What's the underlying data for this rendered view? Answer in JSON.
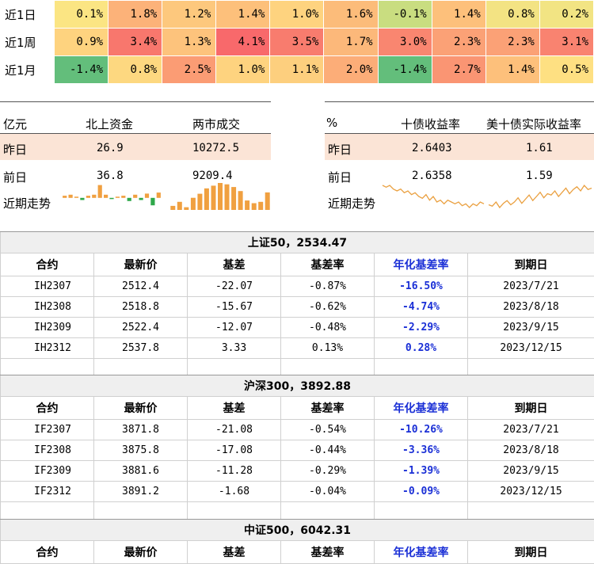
{
  "heatmap": {
    "rows": [
      {
        "label": "近1日",
        "values": [
          "0.1%",
          "1.8%",
          "1.2%",
          "1.4%",
          "1.0%",
          "1.6%",
          "-0.1%",
          "1.4%",
          "0.8%",
          "0.2%"
        ],
        "colors": [
          "#fbe583",
          "#fcb279",
          "#fdc87d",
          "#fdc07b",
          "#fed37f",
          "#fcbc7a",
          "#c9dd80",
          "#fdc07b",
          "#f3e383",
          "#f2e483"
        ]
      },
      {
        "label": "近1周",
        "values": [
          "0.9%",
          "3.4%",
          "1.3%",
          "4.1%",
          "3.5%",
          "1.7%",
          "3.0%",
          "2.3%",
          "2.3%",
          "3.1%"
        ],
        "colors": [
          "#fed37f",
          "#f8776d",
          "#fdc37c",
          "#f8696b",
          "#f87c6e",
          "#fcb87a",
          "#f98670",
          "#fba176",
          "#fba176",
          "#f98370"
        ]
      },
      {
        "label": "近1月",
        "values": [
          "-1.4%",
          "0.8%",
          "2.5%",
          "1.0%",
          "1.1%",
          "2.0%",
          "-1.4%",
          "2.7%",
          "1.4%",
          "0.5%"
        ],
        "colors": [
          "#63be7b",
          "#fdd880",
          "#fb9c74",
          "#fed37f",
          "#fdcf7e",
          "#fcad78",
          "#63be7b",
          "#fa9573",
          "#fdc07b",
          "#fee082"
        ]
      }
    ]
  },
  "flows": {
    "unit": "亿元",
    "col1": "北上资金",
    "col2": "两市成交",
    "yesterday_label": "昨日",
    "prev_label": "前日",
    "trend_label": "近期走势",
    "yesterday": [
      "26.9",
      "10272.5"
    ],
    "prev": [
      "36.8",
      "9209.4"
    ],
    "north_trend": [
      2,
      3,
      1,
      -2,
      2,
      3,
      12,
      3,
      -1,
      1,
      2,
      -3,
      3,
      -2,
      4,
      -7,
      5
    ],
    "turnover_trend": [
      3,
      6,
      2,
      9,
      12,
      16,
      18,
      20,
      19,
      17,
      14,
      7,
      5,
      6,
      13
    ]
  },
  "yields": {
    "unit": "%",
    "col1": "十债收益率",
    "col2": "美十债实际收益率",
    "yesterday_label": "昨日",
    "prev_label": "前日",
    "trend_label": "近期走势",
    "yesterday": [
      "2.6403",
      "1.61"
    ],
    "prev": [
      "2.6358",
      "1.59"
    ],
    "cn10y_trend": [
      2.74,
      2.73,
      2.74,
      2.72,
      2.71,
      2.72,
      2.7,
      2.71,
      2.69,
      2.7,
      2.68,
      2.67,
      2.69,
      2.66,
      2.68,
      2.65,
      2.66,
      2.64,
      2.66,
      2.65,
      2.64,
      2.65,
      2.63,
      2.64,
      2.62,
      2.64,
      2.63,
      2.65,
      2.64
    ],
    "us_real_trend": [
      1.5,
      1.49,
      1.52,
      1.48,
      1.51,
      1.53,
      1.5,
      1.52,
      1.55,
      1.51,
      1.54,
      1.57,
      1.53,
      1.56,
      1.59,
      1.55,
      1.58,
      1.57,
      1.6,
      1.56,
      1.59,
      1.62,
      1.58,
      1.61,
      1.63,
      1.6,
      1.64,
      1.61,
      1.62
    ]
  },
  "basis_headers": [
    "合约",
    "最新价",
    "基差",
    "基差率",
    "年化基差率",
    "到期日"
  ],
  "basis": [
    {
      "title": "上证50，2534.47",
      "rows": [
        [
          "IH2307",
          "2512.4",
          "-22.07",
          "-0.87%",
          "-16.50%",
          "2023/7/21"
        ],
        [
          "IH2308",
          "2518.8",
          "-15.67",
          "-0.62%",
          "-4.74%",
          "2023/8/18"
        ],
        [
          "IH2309",
          "2522.4",
          "-12.07",
          "-0.48%",
          "-2.29%",
          "2023/9/15"
        ],
        [
          "IH2312",
          "2537.8",
          "3.33",
          "0.13%",
          "0.28%",
          "2023/12/15"
        ]
      ]
    },
    {
      "title": "沪深300，3892.88",
      "rows": [
        [
          "IF2307",
          "3871.8",
          "-21.08",
          "-0.54%",
          "-10.26%",
          "2023/7/21"
        ],
        [
          "IF2308",
          "3875.8",
          "-17.08",
          "-0.44%",
          "-3.36%",
          "2023/8/18"
        ],
        [
          "IF2309",
          "3881.6",
          "-11.28",
          "-0.29%",
          "-1.39%",
          "2023/9/15"
        ],
        [
          "IF2312",
          "3891.2",
          "-1.68",
          "-0.04%",
          "-0.09%",
          "2023/12/15"
        ]
      ]
    },
    {
      "title": "中证500，6042.31",
      "rows": []
    }
  ],
  "colors": {
    "bar_orange": "#f0a040",
    "bar_green": "#2ea84a",
    "line_orange": "#eaa040",
    "band": "#fbe4d6",
    "annual_blue": "#1a2fd6"
  }
}
